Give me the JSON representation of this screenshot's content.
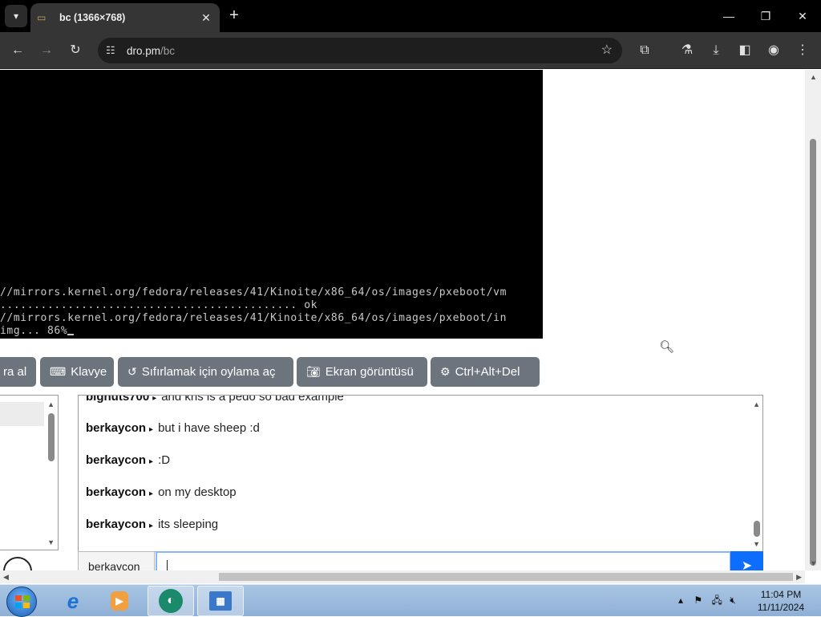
{
  "browser": {
    "tab_title": "bc (1366×768)",
    "url_host": "dro.pm",
    "url_path": "/bc"
  },
  "vm": {
    "lines": [
      "//mirrors.kernel.org/fedora/releases/41/Kinoite/x86_64/os/images/pxeboot/vm",
      "............................................ ok",
      "//mirrors.kernel.org/fedora/releases/41/Kinoite/x86_64/os/images/pxeboot/in",
      "img... 86%"
    ],
    "progress_percent": 86
  },
  "controls": {
    "take_turn": "ra al",
    "keyboard": "Klavye",
    "vote_reset": "Sıfırlamak için oylama aç",
    "screenshot": "Ekran görüntüsü",
    "ctrl_alt_del": "Ctrl+Alt+Del"
  },
  "chat": {
    "partial_message": {
      "user": "bignuts700",
      "text": "and khs is a pedo so bad example"
    },
    "messages": [
      {
        "user": "berkaycon",
        "text": "but i have sheep :d"
      },
      {
        "user": "berkaycon",
        "text": ":D"
      },
      {
        "user": "berkaycon",
        "text": "on my desktop"
      },
      {
        "user": "berkaycon",
        "text": "its sleeping"
      }
    ],
    "username": "berkaycon",
    "input_value": ""
  },
  "taskbar": {
    "time": "11:04 PM",
    "date": "11/11/2024"
  },
  "colors": {
    "button_gray": "#6c757d",
    "send_blue": "#0d6efd",
    "taskbar": "#a9c5e3"
  }
}
